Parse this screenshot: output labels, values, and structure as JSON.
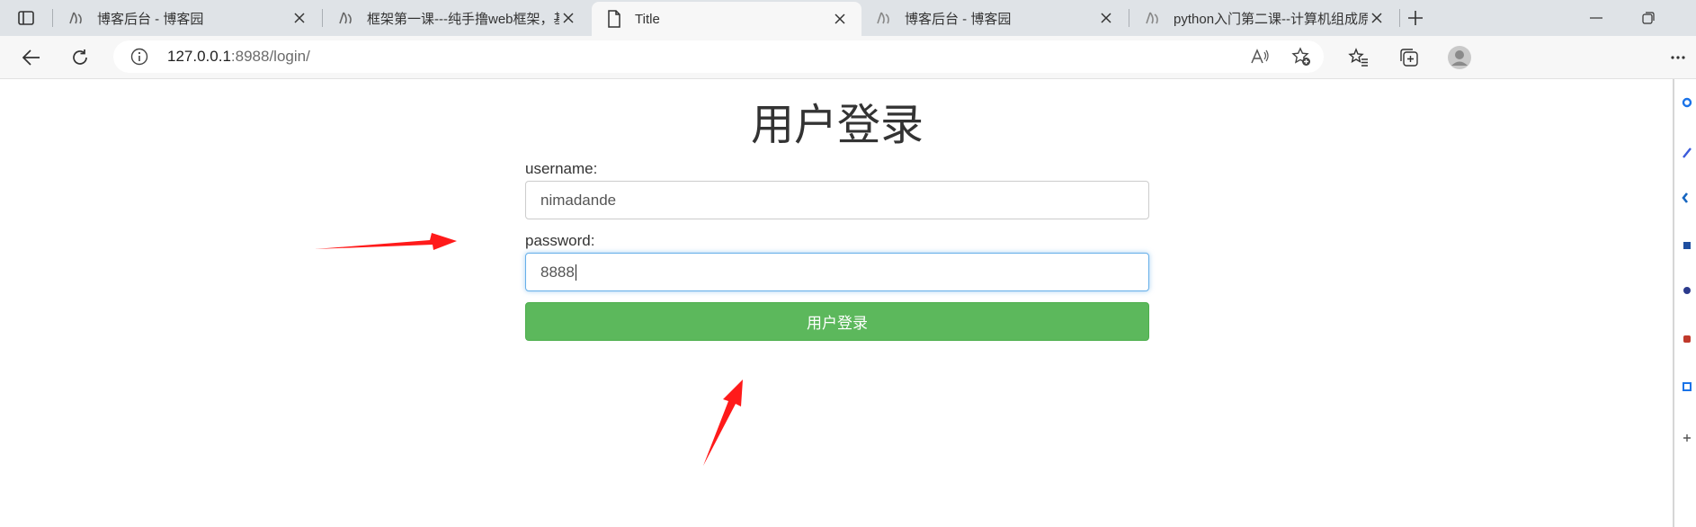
{
  "tabs": [
    {
      "title": "博客后台 - 博客园",
      "active": false,
      "icon": "cnblogs-icon"
    },
    {
      "title": "框架第一课---纯手撸web框架，基",
      "active": false,
      "icon": "cnblogs-icon"
    },
    {
      "title": "Title",
      "active": true,
      "icon": "page-icon"
    },
    {
      "title": "博客后台 - 博客园",
      "active": false,
      "icon": "cnblogs-icon"
    },
    {
      "title": "python入门第二课--计算机组成原",
      "active": false,
      "icon": "cnblogs-icon"
    }
  ],
  "address": {
    "host": "127.0.0.1",
    "rest": ":8988/login/"
  },
  "login": {
    "title": "用户登录",
    "username_label": "username:",
    "username_value": "nimadande",
    "password_label": "password:",
    "password_value": "8888",
    "submit_label": "用户登录"
  },
  "colors": {
    "accent_button": "#5cb85c",
    "annotation_arrow": "#ff1a1a",
    "focus_border": "#66afe9"
  }
}
